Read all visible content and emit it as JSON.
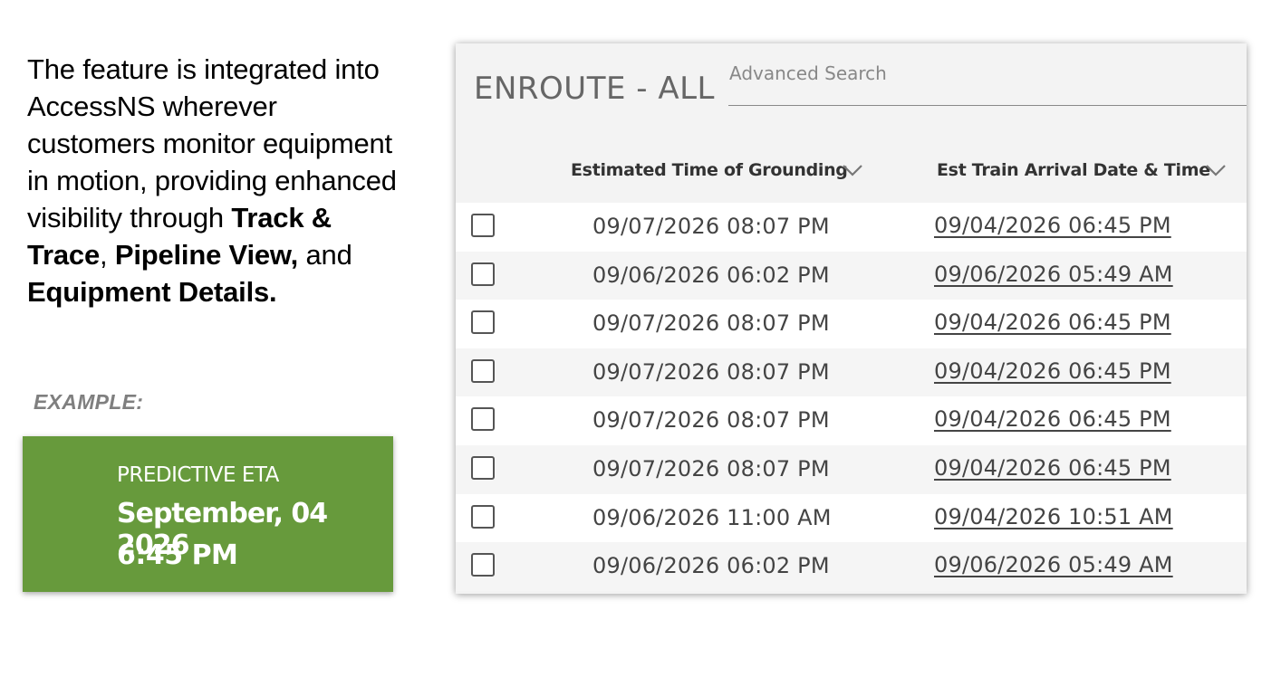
{
  "intro": {
    "text_1": "The feature is integrated into AccessNS wherever customers monitor equipment in motion, providing enhanced visibility through ",
    "bold_1": "Track & Trace",
    "text_2": ", ",
    "bold_2": "Pipeline View,",
    "text_3": " and ",
    "bold_3": "Equipment Details."
  },
  "example_label": "EXAMPLE:",
  "eta_card": {
    "title": "PREDICTIVE ETA",
    "date": "September, 04 2026",
    "time": "6:45 PM",
    "background_color": "#679a3c"
  },
  "panel": {
    "title": "ENROUTE - ALL",
    "search_placeholder": "Advanced Search",
    "columns": [
      {
        "label": "Estimated Time of Grounding",
        "icon": "chevron-down-icon"
      },
      {
        "label": "Est Train Arrival Date & Time",
        "icon": "chevron-down-icon"
      }
    ],
    "rows": [
      {
        "grounding": "09/07/2026 08:07 PM",
        "arrival": "09/04/2026 06:45 PM"
      },
      {
        "grounding": "09/06/2026 06:02 PM",
        "arrival": "09/06/2026 05:49 AM"
      },
      {
        "grounding": "09/07/2026 08:07 PM",
        "arrival": "09/04/2026 06:45 PM"
      },
      {
        "grounding": "09/07/2026 08:07 PM",
        "arrival": "09/04/2026 06:45 PM"
      },
      {
        "grounding": "09/07/2026 08:07 PM",
        "arrival": "09/04/2026 06:45 PM"
      },
      {
        "grounding": "09/07/2026 08:07 PM",
        "arrival": "09/04/2026 06:45 PM"
      },
      {
        "grounding": "09/06/2026 11:00 AM",
        "arrival": "09/04/2026 10:51 AM"
      },
      {
        "grounding": "09/06/2026 06:02 PM",
        "arrival": "09/06/2026 05:49 AM"
      }
    ]
  }
}
